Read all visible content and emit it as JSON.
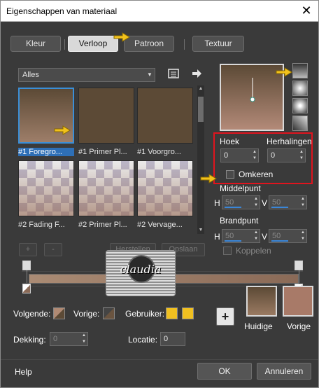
{
  "window": {
    "title": "Eigenschappen van materiaal"
  },
  "tabs": [
    {
      "label": "Kleur"
    },
    {
      "label": "Verloop"
    },
    {
      "label": "Patroon"
    },
    {
      "label": "Textuur"
    }
  ],
  "gallery": {
    "filter": "Alles",
    "items": [
      {
        "label": "#1 Foregro..."
      },
      {
        "label": "#1 Primer Pl..."
      },
      {
        "label": "#1 Voorgro..."
      },
      {
        "label": "#2 Fading F..."
      },
      {
        "label": "#2 Primer Pl..."
      },
      {
        "label": "#2 Vervage..."
      }
    ],
    "add_label": "+",
    "remove_label": "-",
    "restore_label": "Herstellen",
    "save_label": "Opslaan"
  },
  "settings": {
    "angle_label": "Hoek",
    "angle_value": "0",
    "repeats_label": "Herhalingen",
    "repeats_value": "0",
    "invert_label": "Omkeren",
    "center_label": "Middelpunt",
    "center_h_label": "H",
    "center_h": "50",
    "center_v_label": "V",
    "center_v": "50",
    "focal_label": "Brandpunt",
    "focal_h_label": "H",
    "focal_h": "50",
    "focal_v_label": "V",
    "focal_v": "50",
    "link_label": "Koppelen"
  },
  "watermark": {
    "text": "claudia"
  },
  "stops": {
    "next_label": "Volgende:",
    "prev_label": "Vorige:",
    "user_label": "Gebruiker:",
    "opacity_label": "Dekking:",
    "opacity_value": "0",
    "location_label": "Locatie:",
    "location_value": "0"
  },
  "colors": {
    "current_label": "Huidige",
    "previous_label": "Vorige",
    "current_color": "#5c4a36",
    "previous_color": "#a87a68",
    "user_color": "#f0c020",
    "gradient_start": "#aa8b74",
    "gradient_end": "#8a6a57"
  },
  "footer": {
    "help_label": "Help",
    "ok_label": "OK",
    "cancel_label": "Annuleren"
  }
}
